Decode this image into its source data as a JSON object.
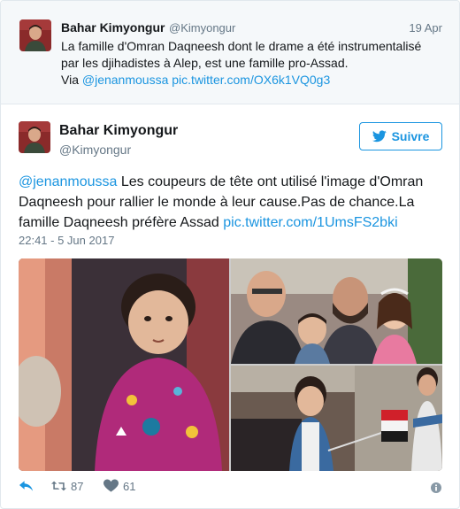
{
  "parent_tweet": {
    "author_name": "Bahar Kimyongur",
    "author_handle": "@Kimyongur",
    "date": "19 Apr",
    "text_line_1": "La famille d'Omran Daqneesh dont le drame a été instrumentalisé",
    "text_line_2": "par les djihadistes à Alep, est une famille pro-Assad.",
    "text_prefix_line_3": "Via ",
    "mention": "@jenanmoussa",
    "link": "pic.twitter.com/OX6k1VQ0g3"
  },
  "tweet": {
    "author_name": "Bahar Kimyongur",
    "author_handle": "@Kimyongur",
    "follow_label": "Suivre",
    "mention": "@jenanmoussa",
    "text_line_1_rest": " Les coupeurs de tête ont utilisé l'image d'Omran",
    "text_line_2": "Daqneesh pour rallier le monde à leur cause.Pas de chance.La",
    "text_line_3_prefix": "famille Daqneesh préfère Assad ",
    "link": "pic.twitter.com/1UmsFS2bki",
    "timestamp": "22:41 - 5 Jun 2017"
  },
  "actions": {
    "retweet_count": "87",
    "like_count": "61"
  },
  "colors": {
    "link": "#1b95e0",
    "muted": "#657786",
    "parent_bg": "#f5f8fa",
    "border": "#e1e8ed"
  },
  "icons": [
    "avatar",
    "twitter-bird-icon",
    "reply-icon",
    "retweet-icon",
    "heart-icon",
    "info-icon"
  ]
}
